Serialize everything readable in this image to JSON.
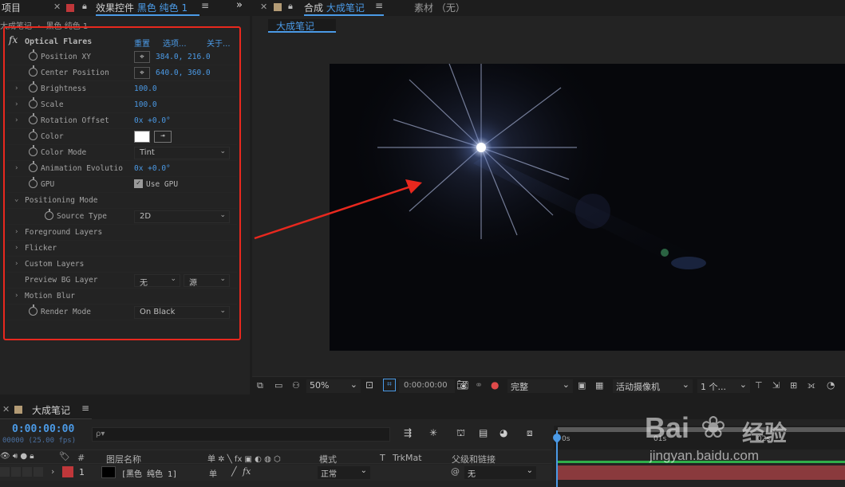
{
  "left_panel": {
    "tab_project": "项目",
    "tab_effects": "效果控件",
    "tab_effects_layer": "黑色 纯色 1",
    "breadcrumb_comp": "大成笔记",
    "breadcrumb_sep": "·",
    "breadcrumb_layer": "黑色 纯色 1",
    "effect_name": "Optical Flares",
    "reset": "重置",
    "options": "选项...",
    "about": "关于...",
    "props": [
      {
        "label": "Position XY",
        "value": "384.0, 216.0"
      },
      {
        "label": "Center Position",
        "value": "640.0, 360.0"
      },
      {
        "label": "Brightness",
        "value": "100.0"
      },
      {
        "label": "Scale",
        "value": "100.0"
      },
      {
        "label": "Rotation Offset",
        "value": "0x +0.0°"
      },
      {
        "label": "Color",
        "value": ""
      },
      {
        "label": "Color Mode",
        "value": "Tint"
      },
      {
        "label": "Animation Evolutio",
        "value": "0x +0.0°"
      },
      {
        "label": "GPU",
        "value": "Use GPU"
      },
      {
        "label": "Positioning Mode",
        "value": ""
      },
      {
        "label": "Source Type",
        "value": "2D"
      },
      {
        "label": "Foreground Layers",
        "value": ""
      },
      {
        "label": "Flicker",
        "value": ""
      },
      {
        "label": "Custom Layers",
        "value": ""
      },
      {
        "label": "Preview BG Layer",
        "value": "无",
        "value2": "源"
      },
      {
        "label": "Motion Blur",
        "value": ""
      },
      {
        "label": "Render Mode",
        "value": "On Black"
      }
    ]
  },
  "comp_panel": {
    "tab_label": "合成",
    "tab_comp": "大成笔记",
    "tab_footage": "素材 （无）",
    "sub_tab": "大成笔记"
  },
  "viewer_toolbar": {
    "zoom": "50%",
    "timecode": "0:00:00:00",
    "resolution": "完整",
    "camera": "活动摄像机",
    "views": "1 个..."
  },
  "timeline": {
    "tab": "大成笔记",
    "timecode": "0:00:00:00",
    "frames": "00000 (25.00 fps)",
    "search_placeholder": "ρ▾",
    "col_num": "#",
    "col_layer_name": "图层名称",
    "col_mode": "模式",
    "col_t": "T",
    "col_trkmat": "TrkMat",
    "col_parent": "父级和链接",
    "layer_index": "1",
    "layer_name": "[黑色 纯色 1]",
    "layer_mode": "正常",
    "layer_parent": "无",
    "ruler_0": "0s",
    "ruler_1": "01s",
    "ruler_2": "02s"
  },
  "watermark": {
    "brand": "Bai",
    "brand2": "经验",
    "url": "jingyan.baidu.com"
  },
  "colors": {
    "accent": "#4b9ae6",
    "annotation_red": "#e8281e",
    "panel_bg": "#232323"
  }
}
